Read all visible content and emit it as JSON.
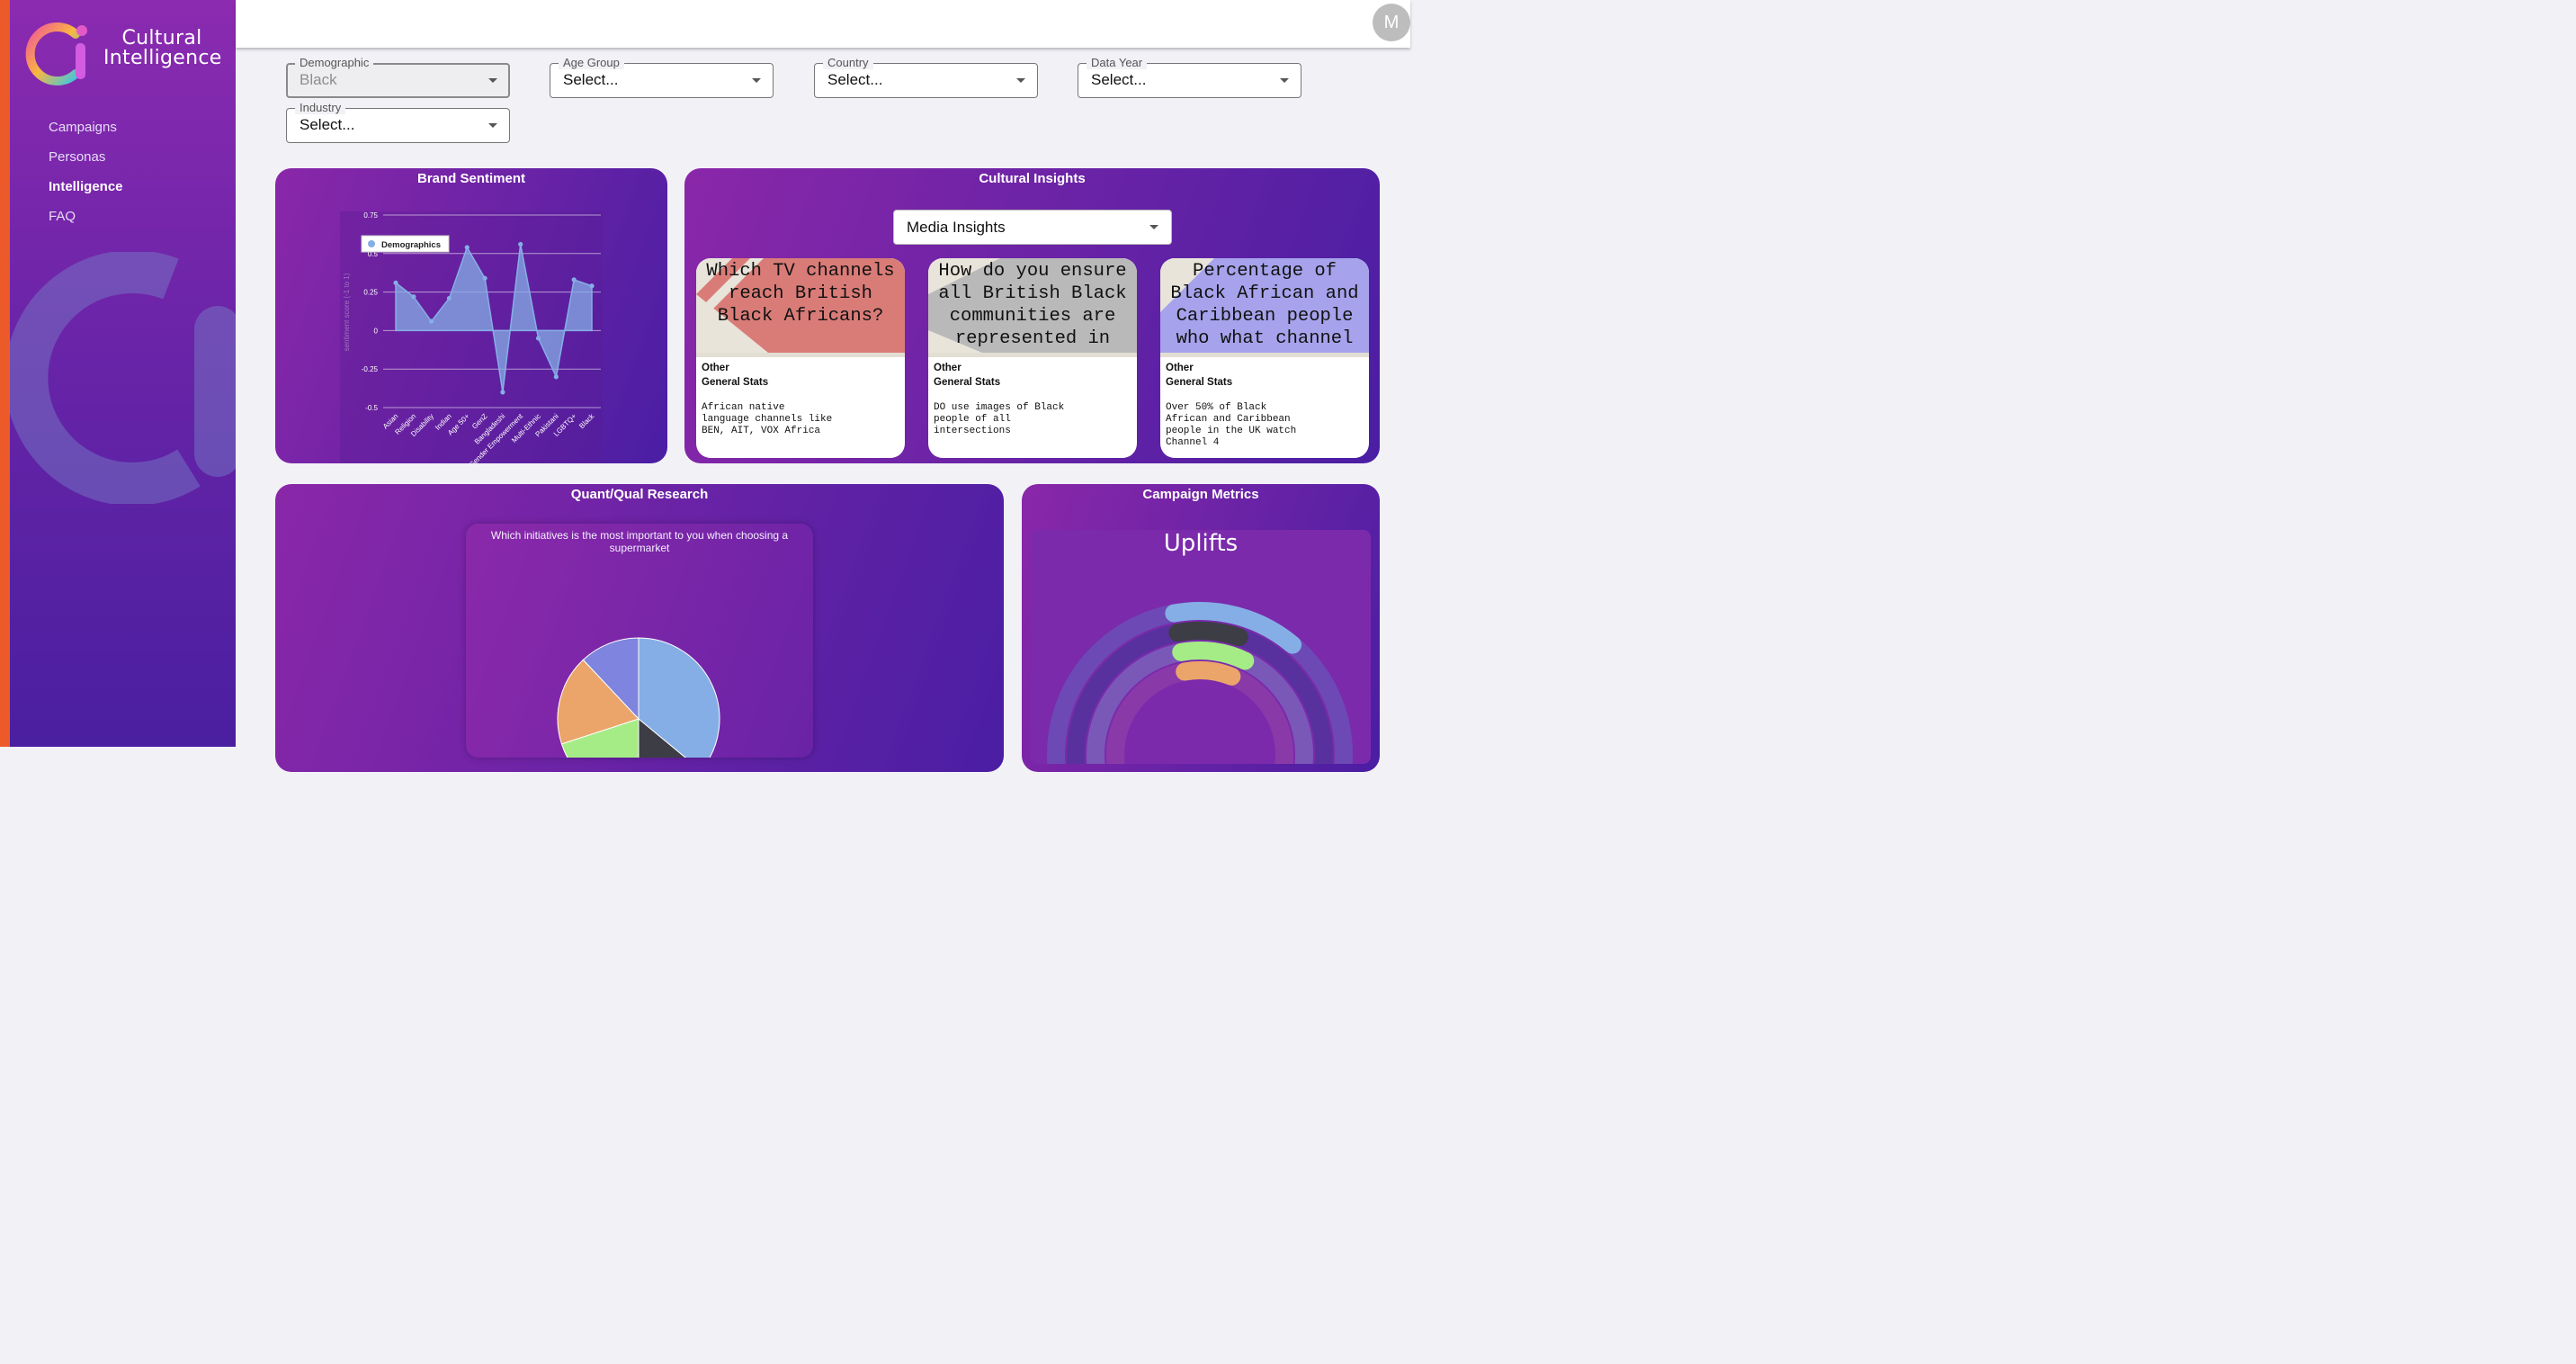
{
  "app": {
    "name_line1": "Cultural",
    "name_line2": "Intelligence"
  },
  "nav": {
    "items": [
      {
        "label": "Campaigns",
        "active": false
      },
      {
        "label": "Personas",
        "active": false
      },
      {
        "label": "Intelligence",
        "active": true
      },
      {
        "label": "FAQ",
        "active": false
      }
    ]
  },
  "user": {
    "avatar_initial": "M"
  },
  "filters": {
    "demographic": {
      "label": "Demographic",
      "value": "Black",
      "disabled": true
    },
    "age_group": {
      "label": "Age Group",
      "value": "Select..."
    },
    "country": {
      "label": "Country",
      "value": "Select..."
    },
    "data_year": {
      "label": "Data Year",
      "value": "Select..."
    },
    "industry": {
      "label": "Industry",
      "value": "Select..."
    }
  },
  "panels": {
    "brand_sentiment": {
      "title": "Brand Sentiment"
    },
    "cultural_insights": {
      "title": "Cultural Insights",
      "selector_value": "Media Insights"
    },
    "research": {
      "title": "Quant/Qual Research",
      "question": "Which initiatives is the most important to you when choosing a supermarket"
    },
    "campaign_metrics": {
      "title": "Campaign Metrics",
      "card_title": "Uplifts"
    }
  },
  "insight_cards": [
    {
      "question": "Which TV channels reach British Black Africans?",
      "category": "Other",
      "subcategory": "General Stats",
      "body": "African native language channels like BEN, AIT, VOX Africa",
      "color": "#d97c78"
    },
    {
      "question": "How do you ensure all British Black communities are represented in",
      "category": "Other",
      "subcategory": "General Stats",
      "body": "DO use images of Black people of all intersections",
      "color": "#b9b9b9"
    },
    {
      "question": "Percentage of Black African and Caribbean people who what channel",
      "category": "Other",
      "subcategory": "General Stats",
      "body": "Over 50% of Black African and Caribbean people in the UK watch Channel 4",
      "color": "#a6a3ec"
    }
  ],
  "chart_data": [
    {
      "type": "area",
      "title": "",
      "legend": [
        "Demographics"
      ],
      "legend_position": "top-left",
      "ylabel": "sentiment score (-1 to 1)",
      "ylim": [
        -0.5,
        0.75
      ],
      "yticks": [
        "0.75",
        "0.5",
        "0.25",
        "0",
        "-0.25",
        "-0.5"
      ],
      "grid": true,
      "categories": [
        "Asian",
        "Religion",
        "Disability",
        "Indian",
        "Age 50+",
        "GenZ",
        "Bangladeshi",
        "Gender Empowerment",
        "Multi-Ethnic",
        "Pakistani",
        "LGBTQ+",
        "Black"
      ],
      "series": [
        {
          "name": "Demographics",
          "values": [
            0.31,
            0.22,
            0.06,
            0.21,
            0.54,
            0.34,
            -0.4,
            0.56,
            -0.05,
            -0.3,
            0.33,
            0.29
          ],
          "color": "#86aee6"
        }
      ]
    },
    {
      "type": "pie",
      "title": "",
      "colors": [
        "#86aee6",
        "#3d3d45",
        "#a6ec86",
        "#eba56a",
        "#7f84de"
      ],
      "values": [
        0.36,
        0.14,
        0.2,
        0.18,
        0.12
      ]
    },
    {
      "type": "radial-bar",
      "title": "Uplifts",
      "colors": [
        "#86aee6",
        "#3d3d45",
        "#a6ec86",
        "#eba56a"
      ],
      "values": [
        0.14,
        0.08,
        0.1,
        0.09
      ]
    }
  ]
}
